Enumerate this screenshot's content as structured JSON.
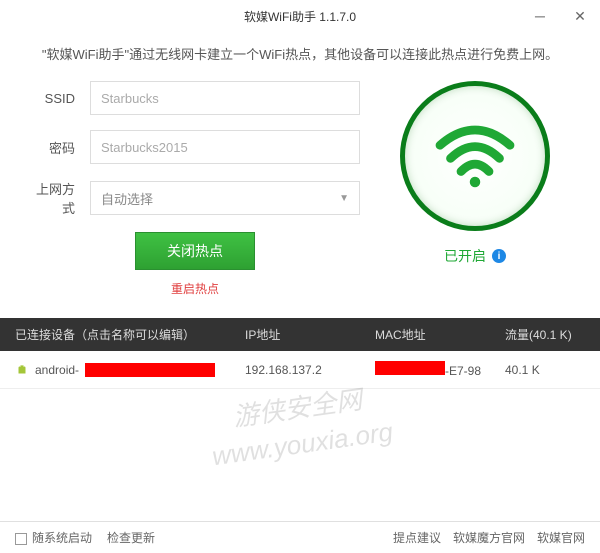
{
  "titlebar": {
    "title": "软媒WiFi助手 1.1.7.0"
  },
  "description": "\"软媒WiFi助手\"通过无线网卡建立一个WiFi热点，其他设备可以连接此热点进行免费上网。",
  "form": {
    "ssid_label": "SSID",
    "ssid_value": "Starbucks",
    "password_label": "密码",
    "password_value": "Starbucks2015",
    "method_label": "上网方式",
    "method_value": "自动选择",
    "close_button": "关闭热点",
    "restart_link": "重启热点"
  },
  "status": {
    "text": "已开启"
  },
  "table": {
    "header": {
      "devices": "已连接设备（点击名称可以编辑）",
      "ip": "IP地址",
      "mac": "MAC地址",
      "traffic": "流量(40.1 K)"
    },
    "rows": [
      {
        "device_prefix": "android-",
        "ip": "192.168.137.2",
        "mac_suffix": "-E7-98",
        "traffic": "40.1 K"
      }
    ]
  },
  "watermark": {
    "line1": "游侠安全网",
    "line2": "www.youxia.org"
  },
  "footer": {
    "startup": "随系统启动",
    "check_update": "检查更新",
    "suggest": "提点建议",
    "mofang": "软媒魔方官网",
    "official": "软媒官网"
  }
}
